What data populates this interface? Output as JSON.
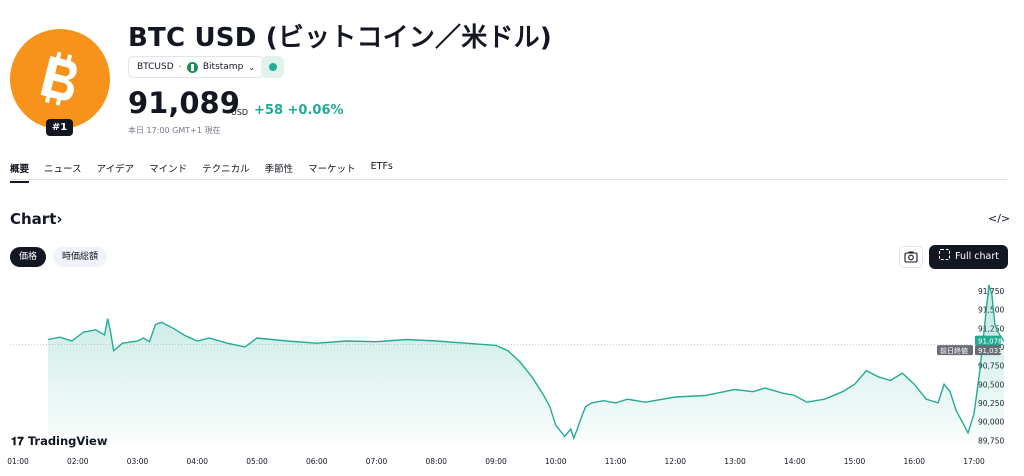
{
  "asset": {
    "title": "BTC USD (ビットコイン／米ドル)",
    "rank": "#1",
    "symbol": "BTCUSD",
    "exchange": "Bitstamp",
    "price": "91,089",
    "currency": "USD",
    "change": "+58",
    "change_pct": "+0.06%",
    "as_of": "本日 17:00 GMT+1 現在",
    "colors": {
      "logo": "#f7931a",
      "up": "#22ab94",
      "dark": "#131722"
    }
  },
  "tabs": [
    {
      "label": "概要"
    },
    {
      "label": "ニュース"
    },
    {
      "label": "アイデア"
    },
    {
      "label": "マインド"
    },
    {
      "label": "テクニカル"
    },
    {
      "label": "季節性"
    },
    {
      "label": "マーケット"
    },
    {
      "label": "ETFs"
    }
  ],
  "chart_section": {
    "heading": "Chart",
    "price_pill": "価格",
    "mcap_pill": "時価総額",
    "full_chart": "Full chart",
    "embed_icon": "code-icon",
    "screenshot_icon": "camera-icon",
    "branding": "TradingView"
  },
  "chart_data": {
    "type": "area",
    "x_ticks": [
      "01:00",
      "02:00",
      "03:00",
      "04:00",
      "05:00",
      "06:00",
      "07:00",
      "08:00",
      "09:00",
      "10:00",
      "11:00",
      "12:00",
      "13:00",
      "14:00",
      "15:00",
      "16:00",
      "17:00"
    ],
    "y_ticks": [
      "91,750",
      "91,500",
      "91,250",
      "91,000",
      "90,750",
      "90,500",
      "90,250",
      "90,000",
      "89,750"
    ],
    "ylim": [
      89700,
      91950
    ],
    "series": [
      {
        "x": [
          0.5,
          0.7,
          0.9,
          1.1,
          1.3,
          1.45,
          1.5,
          1.55,
          1.6,
          1.75,
          2.0,
          2.1,
          2.2,
          2.3,
          2.4,
          2.6,
          2.8,
          3.0,
          3.2,
          3.5,
          3.8,
          4.0,
          4.5,
          5.0,
          5.5,
          6.0,
          6.5,
          7.0,
          7.5,
          8.0,
          8.2,
          8.4,
          8.6,
          8.8,
          8.9,
          9.0,
          9.15,
          9.25,
          9.3,
          9.35,
          9.45,
          9.5,
          9.6,
          9.8,
          10.0,
          10.2,
          10.5,
          11.0,
          11.5,
          12.0,
          12.3,
          12.5,
          12.8,
          13.0,
          13.2,
          13.5,
          13.8,
          14.0,
          14.2,
          14.4,
          14.6,
          14.8,
          15.0,
          15.2,
          15.4,
          15.5,
          15.6,
          15.7,
          15.8,
          15.9,
          16.0,
          16.1,
          16.2,
          16.25,
          16.3,
          16.35,
          16.4,
          16.5
        ],
        "values": [
          91100,
          91130,
          91080,
          91200,
          91230,
          91160,
          91380,
          91200,
          90950,
          91050,
          91080,
          91120,
          91070,
          91300,
          91330,
          91250,
          91150,
          91080,
          91120,
          91050,
          91000,
          91120,
          91080,
          91050,
          91080,
          91070,
          91100,
          91080,
          91050,
          91020,
          90950,
          90800,
          90600,
          90350,
          90200,
          89950,
          89800,
          89900,
          89780,
          89880,
          90100,
          90200,
          90250,
          90280,
          90250,
          90300,
          90260,
          90330,
          90350,
          90430,
          90400,
          90450,
          90380,
          90350,
          90260,
          90300,
          90400,
          90500,
          90680,
          90600,
          90550,
          90650,
          90500,
          90300,
          90250,
          90500,
          90400,
          90150,
          90000,
          89850,
          90100,
          90700,
          91450,
          91830,
          91700,
          91300,
          91200,
          91078
        ]
      }
    ],
    "previous_close": {
      "label": "前日終値",
      "value": "91,031"
    },
    "last_value_label": "91,078",
    "line_color": "#22ab94"
  }
}
